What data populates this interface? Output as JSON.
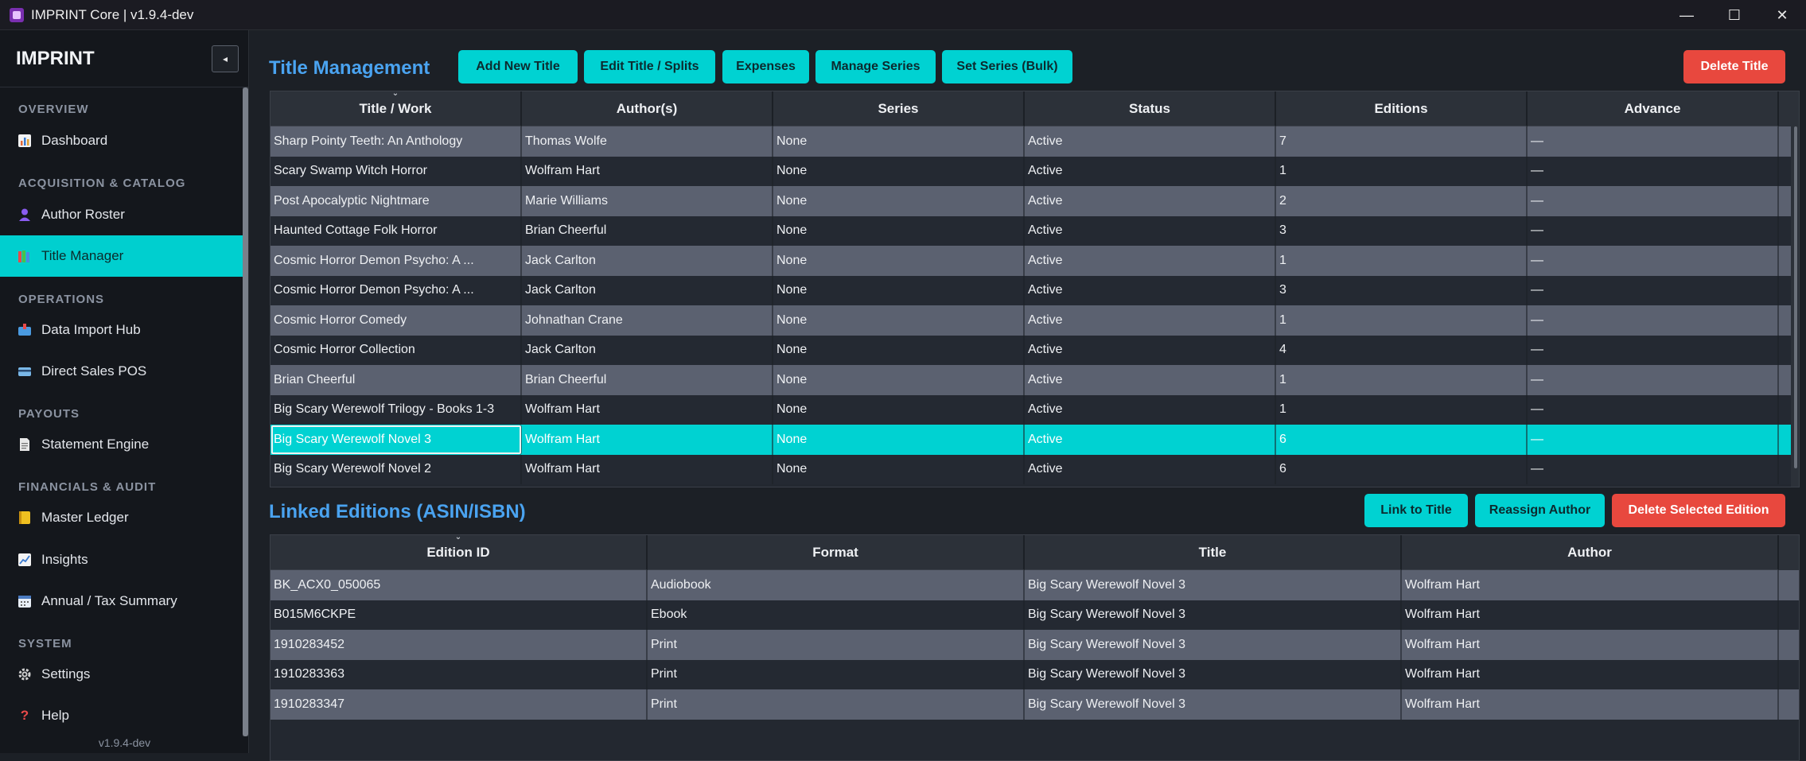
{
  "window": {
    "title": "IMPRINT Core | v1.9.4-dev",
    "controls": {
      "minimize": "—",
      "maximize": "☐",
      "close": "✕"
    }
  },
  "sidebar": {
    "brand": "IMPRINT",
    "collapse_glyph": "◂",
    "version": "v1.9.4-dev",
    "sections": {
      "overview": "OVERVIEW",
      "acquisition": "ACQUISITION & CATALOG",
      "operations": "OPERATIONS",
      "payouts": "PAYOUTS",
      "financials": "FINANCIALS & AUDIT",
      "system": "SYSTEM"
    },
    "items": {
      "dashboard": {
        "label": "Dashboard",
        "icon": "bar-chart-icon",
        "color": "#e8a24a"
      },
      "author_roster": {
        "label": "Author Roster",
        "icon": "person-icon",
        "color": "#8a5cf0"
      },
      "title_manager": {
        "label": "Title Manager",
        "icon": "books-icon",
        "color": "#f0a030"
      },
      "data_import": {
        "label": "Data Import Hub",
        "icon": "inbox-icon",
        "color": "#4a9ae0"
      },
      "direct_sales": {
        "label": "Direct Sales POS",
        "icon": "card-icon",
        "color": "#5aa0e0"
      },
      "statement_engine": {
        "label": "Statement Engine",
        "icon": "document-icon",
        "color": "#d8d8d8"
      },
      "master_ledger": {
        "label": "Master Ledger",
        "icon": "ledger-icon",
        "color": "#f0c020"
      },
      "insights": {
        "label": "Insights",
        "icon": "trend-icon",
        "color": "#70b0f0"
      },
      "annual_tax": {
        "label": "Annual / Tax Summary",
        "icon": "calendar-icon",
        "color": "#7ab0e0"
      },
      "settings": {
        "label": "Settings",
        "icon": "gear-icon",
        "color": "#c8c8c8"
      },
      "help": {
        "label": "Help",
        "icon": "question-icon",
        "color": "#e84a4a"
      }
    }
  },
  "title_management": {
    "heading": "Title Management",
    "buttons": {
      "add": "Add New Title",
      "edit": "Edit Title / Splits",
      "expenses": "Expenses",
      "manage_series": "Manage Series",
      "set_series_bulk": "Set Series (Bulk)",
      "delete": "Delete Title"
    },
    "columns": [
      "Title / Work",
      "Author(s)",
      "Series",
      "Status",
      "Editions",
      "Advance"
    ],
    "rows": [
      [
        "Sharp Pointy Teeth: An Anthology",
        "Thomas Wolfe",
        "None",
        "Active",
        "7",
        "—"
      ],
      [
        "Scary Swamp Witch Horror",
        "Wolfram Hart",
        "None",
        "Active",
        "1",
        "—"
      ],
      [
        "Post Apocalyptic Nightmare",
        "Marie Williams",
        "None",
        "Active",
        "2",
        "—"
      ],
      [
        "Haunted Cottage Folk Horror",
        "Brian Cheerful",
        "None",
        "Active",
        "3",
        "—"
      ],
      [
        "Cosmic Horror Demon Psycho: A ...",
        "Jack Carlton",
        "None",
        "Active",
        "1",
        "—"
      ],
      [
        "Cosmic Horror Demon Psycho: A ...",
        "Jack Carlton",
        "None",
        "Active",
        "3",
        "—"
      ],
      [
        "Cosmic Horror Comedy",
        "Johnathan Crane",
        "None",
        "Active",
        "1",
        "—"
      ],
      [
        "Cosmic Horror Collection",
        "Jack Carlton",
        "None",
        "Active",
        "4",
        "—"
      ],
      [
        "Brian Cheerful",
        "Brian Cheerful",
        "None",
        "Active",
        "1",
        "—"
      ],
      [
        "Big Scary Werewolf Trilogy - Books 1-3",
        "Wolfram Hart",
        "None",
        "Active",
        "1",
        "—"
      ],
      [
        "Big Scary Werewolf Novel 3",
        "Wolfram Hart",
        "None",
        "Active",
        "6",
        "—"
      ],
      [
        "Big Scary Werewolf Novel 2",
        "Wolfram Hart",
        "None",
        "Active",
        "6",
        "—"
      ]
    ],
    "selected_row": 10
  },
  "linked_editions": {
    "heading": "Linked Editions (ASIN/ISBN)",
    "buttons": {
      "link": "Link to Title",
      "reassign": "Reassign Author",
      "delete": "Delete Selected Edition"
    },
    "columns": [
      "Edition ID",
      "Format",
      "Title",
      "Author"
    ],
    "rows": [
      [
        "BK_ACX0_050065",
        "Audiobook",
        "Big Scary Werewolf Novel 3",
        "Wolfram Hart"
      ],
      [
        "B015M6CKPE",
        "Ebook",
        "Big Scary Werewolf Novel 3",
        "Wolfram Hart"
      ],
      [
        "1910283452",
        "Print",
        "Big Scary Werewolf Novel 3",
        "Wolfram Hart"
      ],
      [
        "1910283363",
        "Print",
        "Big Scary Werewolf Novel 3",
        "Wolfram Hart"
      ],
      [
        "1910283347",
        "Print",
        "Big Scary Werewolf Novel 3",
        "Wolfram Hart"
      ]
    ]
  }
}
